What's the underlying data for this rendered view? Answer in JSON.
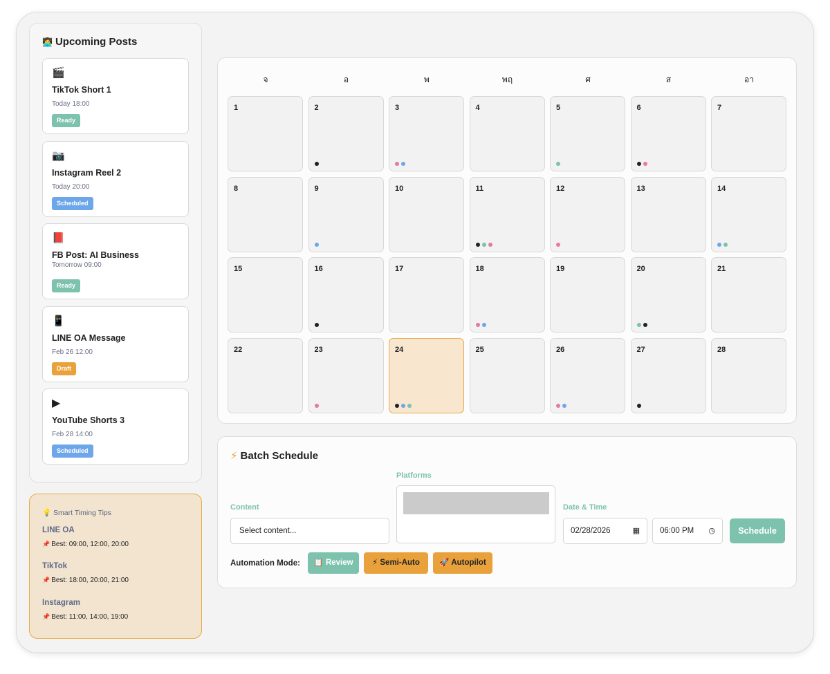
{
  "upcoming": {
    "title": "Upcoming Posts",
    "title_icon": "👩‍💻",
    "posts": [
      {
        "icon": "🎬",
        "icon_name": "clapperboard-icon",
        "title": "TikTok Short 1",
        "time": "Today 18:00",
        "status": "Ready",
        "status_type": "ready"
      },
      {
        "icon": "📷",
        "icon_name": "camera-icon",
        "title": "Instagram Reel 2",
        "time": "Today 20:00",
        "status": "Scheduled",
        "status_type": "scheduled"
      },
      {
        "icon": "📕",
        "icon_name": "book-icon",
        "title": "FB Post: AI Business",
        "time": "Tomorrow 09:00",
        "status": "Ready",
        "status_type": "ready"
      },
      {
        "icon": "📱",
        "icon_name": "phone-icon",
        "title": "LINE OA Message",
        "time": "Feb 26 12:00",
        "status": "Draft",
        "status_type": "draft"
      },
      {
        "icon": "▶",
        "icon_name": "play-icon",
        "title": "YouTube Shorts 3",
        "time": "Feb 28 14:00",
        "status": "Scheduled",
        "status_type": "scheduled"
      }
    ]
  },
  "tips": {
    "title": "Smart Timing Tips",
    "title_icon": "💡",
    "items": [
      {
        "name": "LINE OA",
        "best": "Best: 09:00, 12:00, 20:00"
      },
      {
        "name": "TikTok",
        "best": "Best: 18:00, 20:00, 21:00"
      },
      {
        "name": "Instagram",
        "best": "Best: 11:00, 14:00, 19:00"
      }
    ]
  },
  "calendar": {
    "weekdays": [
      "จ",
      "อ",
      "พ",
      "พฤ",
      "ศ",
      "ส",
      "อา"
    ],
    "today": 24,
    "colors": {
      "black": "#222222",
      "pink": "#e87a9a",
      "blue": "#6ea6ea",
      "green": "#7cc2ad"
    },
    "days": [
      {
        "n": "1",
        "dots": []
      },
      {
        "n": "2",
        "dots": [
          "black"
        ]
      },
      {
        "n": "3",
        "dots": [
          "pink",
          "blue"
        ]
      },
      {
        "n": "4",
        "dots": []
      },
      {
        "n": "5",
        "dots": [
          "green"
        ]
      },
      {
        "n": "6",
        "dots": [
          "black",
          "pink"
        ]
      },
      {
        "n": "7",
        "dots": []
      },
      {
        "n": "8",
        "dots": []
      },
      {
        "n": "9",
        "dots": [
          "blue"
        ]
      },
      {
        "n": "10",
        "dots": []
      },
      {
        "n": "11",
        "dots": [
          "black",
          "green",
          "pink"
        ]
      },
      {
        "n": "12",
        "dots": [
          "pink"
        ]
      },
      {
        "n": "13",
        "dots": []
      },
      {
        "n": "14",
        "dots": [
          "blue",
          "green"
        ]
      },
      {
        "n": "15",
        "dots": []
      },
      {
        "n": "16",
        "dots": [
          "black"
        ]
      },
      {
        "n": "17",
        "dots": []
      },
      {
        "n": "18",
        "dots": [
          "pink",
          "blue"
        ]
      },
      {
        "n": "19",
        "dots": []
      },
      {
        "n": "20",
        "dots": [
          "green",
          "black"
        ]
      },
      {
        "n": "21",
        "dots": []
      },
      {
        "n": "22",
        "dots": []
      },
      {
        "n": "23",
        "dots": [
          "pink"
        ]
      },
      {
        "n": "24",
        "dots": [
          "black",
          "blue",
          "green"
        ]
      },
      {
        "n": "25",
        "dots": []
      },
      {
        "n": "26",
        "dots": [
          "pink",
          "blue"
        ]
      },
      {
        "n": "27",
        "dots": [
          "black"
        ]
      },
      {
        "n": "28",
        "dots": []
      }
    ]
  },
  "batch": {
    "title": "Batch Schedule",
    "title_icon": "⚡",
    "content_label": "Content",
    "content_value": "Select content...",
    "platforms_label": "Platforms",
    "datetime_label": "Date & Time",
    "date_value": "02/28/2026",
    "time_value": "06:00 PM",
    "schedule_label": "Schedule",
    "mode_label": "Automation Mode:",
    "modes": [
      {
        "icon": "📋",
        "label": "Review"
      },
      {
        "icon": "⚡",
        "label": "Semi-Auto"
      },
      {
        "icon": "🚀",
        "label": "Autopilot"
      }
    ]
  }
}
